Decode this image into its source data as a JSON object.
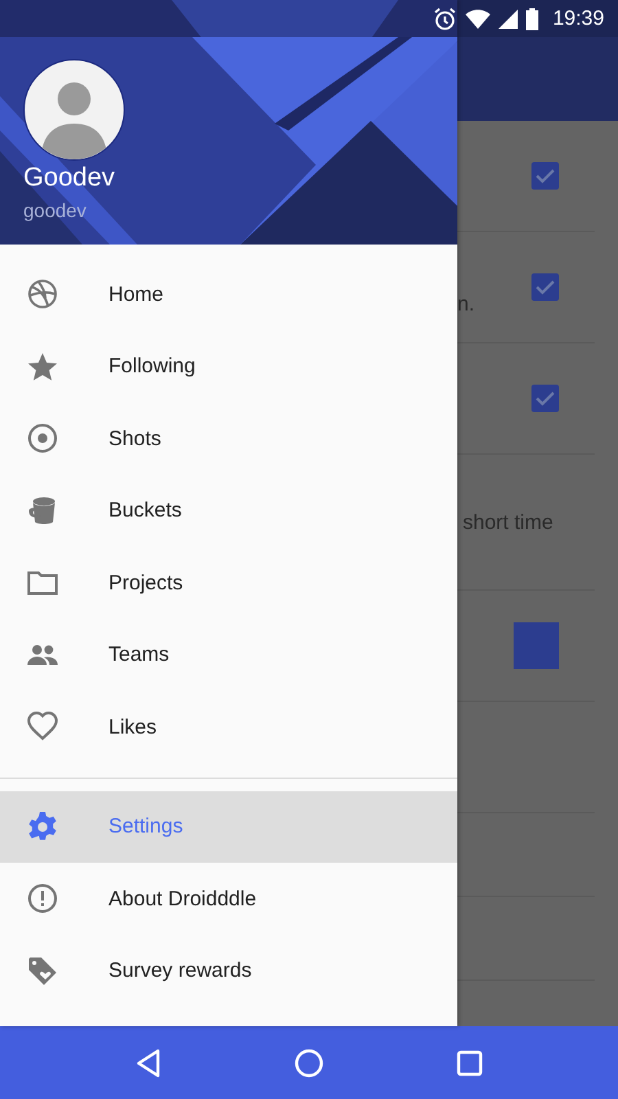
{
  "status_bar": {
    "time": "19:39"
  },
  "drawer": {
    "account": {
      "name": "Goodev",
      "username": "goodev"
    },
    "items": [
      {
        "label": "Home",
        "selected": false
      },
      {
        "label": "Following",
        "selected": false
      },
      {
        "label": "Shots",
        "selected": false
      },
      {
        "label": "Buckets",
        "selected": false
      },
      {
        "label": "Projects",
        "selected": false
      },
      {
        "label": "Teams",
        "selected": false
      },
      {
        "label": "Likes",
        "selected": false
      }
    ],
    "secondary_items": [
      {
        "label": "Settings",
        "selected": true
      },
      {
        "label": "About Droidddle",
        "selected": false
      },
      {
        "label": "Survey rewards",
        "selected": false
      }
    ]
  },
  "background_list": [
    {
      "kind": "checkbox",
      "checked": true
    },
    {
      "kind": "checkbox",
      "checked": true,
      "text": "n."
    },
    {
      "kind": "checkbox",
      "checked": true
    },
    {
      "kind": "text",
      "text": "short time"
    },
    {
      "kind": "swatch"
    },
    {
      "kind": "blank"
    },
    {
      "kind": "blank"
    },
    {
      "kind": "blank"
    }
  ]
}
